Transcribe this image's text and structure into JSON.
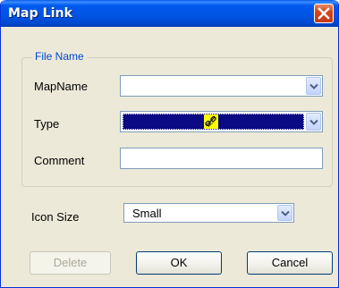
{
  "window": {
    "title": "Map Link",
    "close_icon": "close-icon"
  },
  "file_name_group": {
    "label": "File Name",
    "map_name": {
      "label": "MapName",
      "value": ""
    },
    "type": {
      "label": "Type",
      "value": "",
      "selected_icon": "link-icon"
    },
    "comment": {
      "label": "Comment",
      "value": ""
    }
  },
  "icon_size": {
    "label": "Icon Size",
    "value": "Small"
  },
  "buttons": {
    "delete": "Delete",
    "ok": "OK",
    "cancel": "Cancel"
  },
  "colors": {
    "title_bar": "#0054e3",
    "selection": "#0a0a84",
    "group_label": "#0046d5",
    "dialog_bg": "#ece9d8"
  }
}
